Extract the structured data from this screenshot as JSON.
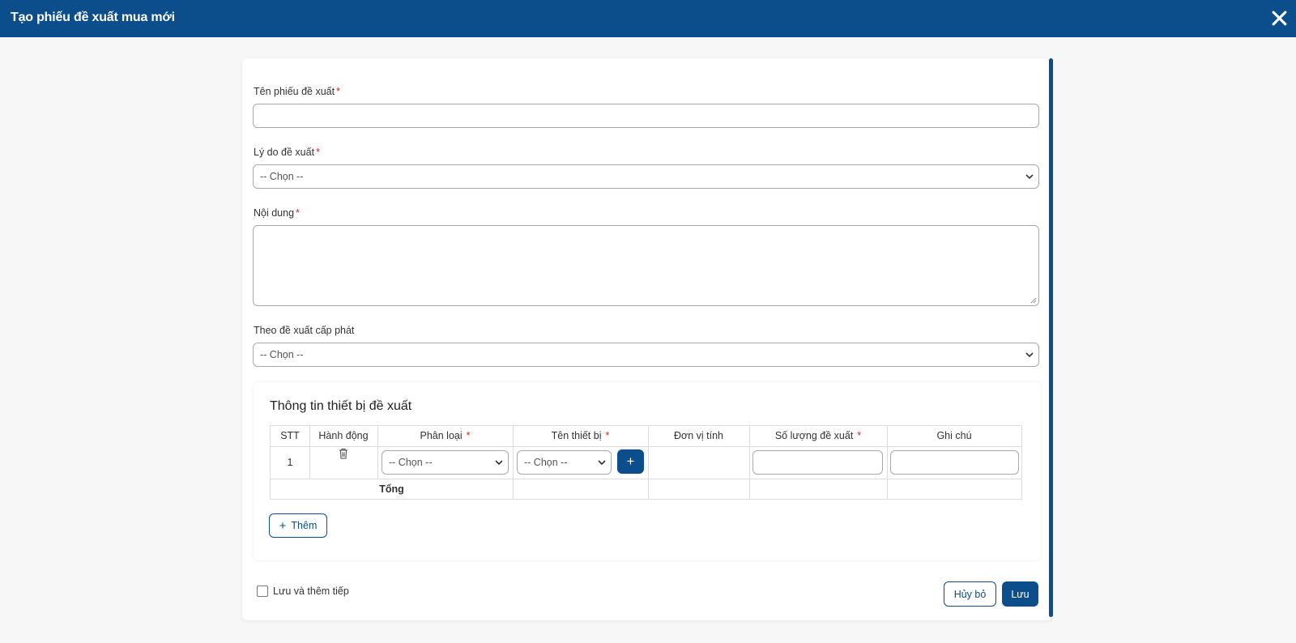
{
  "header": {
    "title": "Tạo phiếu đề xuất mua mới"
  },
  "form": {
    "name_label": "Tên phiếu đề xuất",
    "name_value": "",
    "reason_label": "Lý do đề xuất",
    "reason_selected": "-- Chọn --",
    "content_label": "Nội dung",
    "content_value": "",
    "allocation_label": "Theo đề xuất cấp phát",
    "allocation_selected": "-- Chọn --",
    "required_mark": "*"
  },
  "devices": {
    "title": "Thông tin thiết bị đề xuất",
    "columns": [
      "STT",
      "Hành động",
      "Phân loại",
      "Tên thiết bị",
      "Đơn vị tính",
      "Số lượng đề xuất",
      "Ghi chú"
    ],
    "required_columns": [
      2,
      3,
      5
    ],
    "rows": [
      {
        "stt": "1",
        "category": "-- Chọn --",
        "device": "-- Chọn --",
        "unit": "",
        "quantity": "",
        "note": ""
      }
    ],
    "total_label": "Tổng",
    "add_label": "Thêm"
  },
  "footer": {
    "save_continue_label": "Lưu và thêm tiếp",
    "save_continue_checked": false,
    "cancel_label": "Hủy bỏ",
    "save_label": "Lưu"
  },
  "colors": {
    "primary": "#0c4d8c",
    "required": "#dd2222"
  },
  "icons": {
    "close": "close-icon",
    "delete": "trash-icon",
    "dropdown": "chevron-down-icon",
    "add": "plus-icon"
  }
}
